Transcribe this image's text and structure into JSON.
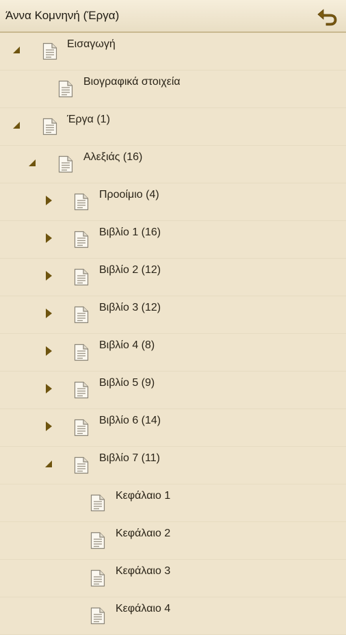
{
  "header": {
    "title": "Άννα Κομνηνή (Έργα)",
    "back_icon": "back-arrow-icon"
  },
  "colors": {
    "background": "#efe4cc",
    "accent": "#7a5a10",
    "divider": "#e6dbc1"
  },
  "tree": [
    {
      "label": "Εισαγωγή",
      "level": 0,
      "state": "expanded"
    },
    {
      "label": "Βιογραφικά στοιχεία",
      "level": 1,
      "state": "leaf"
    },
    {
      "label": "Έργα (1)",
      "level": 0,
      "state": "expanded"
    },
    {
      "label": "Αλεξιάς (16)",
      "level": 1,
      "state": "expanded"
    },
    {
      "label": "Προοίμιο (4)",
      "level": 2,
      "state": "collapsed"
    },
    {
      "label": "Βιβλίο 1 (16)",
      "level": 2,
      "state": "collapsed"
    },
    {
      "label": "Βιβλίο 2 (12)",
      "level": 2,
      "state": "collapsed"
    },
    {
      "label": "Βιβλίο 3 (12)",
      "level": 2,
      "state": "collapsed"
    },
    {
      "label": "Βιβλίο 4 (8)",
      "level": 2,
      "state": "collapsed"
    },
    {
      "label": "Βιβλίο 5 (9)",
      "level": 2,
      "state": "collapsed"
    },
    {
      "label": "Βιβλίο 6 (14)",
      "level": 2,
      "state": "collapsed"
    },
    {
      "label": "Βιβλίο 7 (11)",
      "level": 2,
      "state": "expanded"
    },
    {
      "label": "Κεφάλαιο 1",
      "level": 3,
      "state": "leaf"
    },
    {
      "label": "Κεφάλαιο 2",
      "level": 3,
      "state": "leaf"
    },
    {
      "label": "Κεφάλαιο 3",
      "level": 3,
      "state": "leaf"
    },
    {
      "label": "Κεφάλαιο 4",
      "level": 3,
      "state": "leaf"
    }
  ]
}
